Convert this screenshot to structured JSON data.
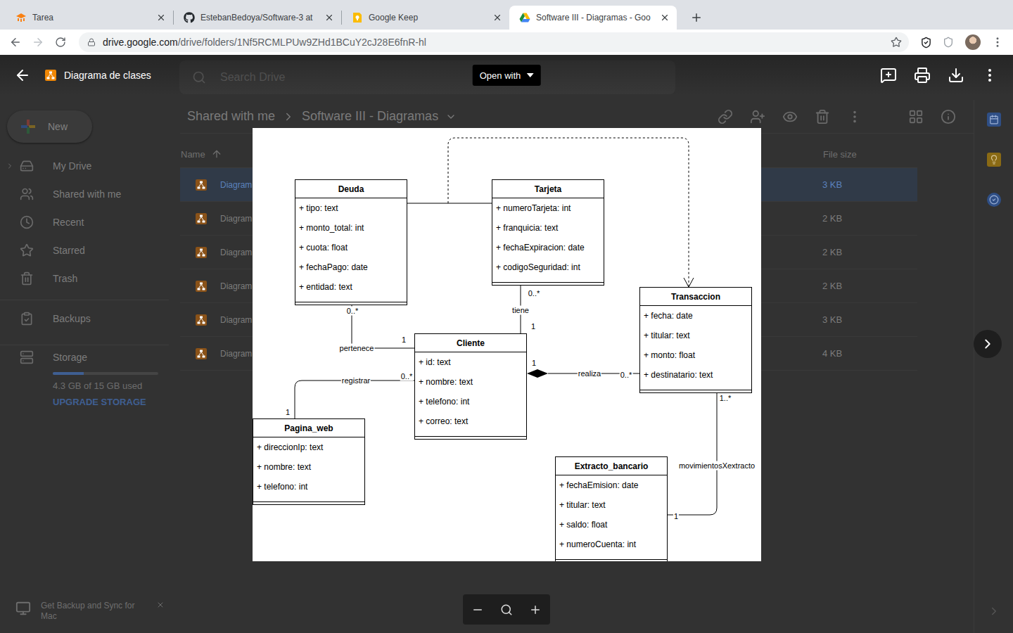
{
  "browser": {
    "tabs": [
      {
        "title": "Tarea",
        "kind": "moodle",
        "selected": false
      },
      {
        "title": "EstebanBedoya/Software-3 at",
        "kind": "github",
        "selected": false
      },
      {
        "title": "Google Keep",
        "kind": "keep",
        "selected": false
      },
      {
        "title": "Software III - Diagramas - Goo",
        "kind": "drive",
        "selected": true
      }
    ],
    "address": {
      "host": "drive.google.com",
      "path": "/drive/folders/1Nf5RCMLPUw9ZHd1BCuY2cJ28E6fnR-hl"
    }
  },
  "drive": {
    "search_placeholder": "Search Drive",
    "new_button": "New",
    "nav": [
      {
        "label": "My Drive",
        "expandable": true,
        "selected": false
      },
      {
        "label": "Shared with me",
        "expandable": false,
        "selected": false
      },
      {
        "label": "Recent",
        "expandable": false,
        "selected": false
      },
      {
        "label": "Starred",
        "expandable": false,
        "selected": false
      },
      {
        "label": "Trash",
        "expandable": false,
        "selected": false
      }
    ],
    "backups": "Backups",
    "storage": {
      "label": "Storage",
      "level": 0.29,
      "used": "4.3 GB of 15 GB used",
      "upgrade": "UPGRADE STORAGE"
    },
    "breadcrumb": [
      "Shared with me",
      "Software III - Diagramas"
    ],
    "columns": {
      "name": "Name",
      "size": "File size"
    },
    "files": [
      {
        "name": "Diagram",
        "size": "3 KB",
        "selected": true
      },
      {
        "name": "Diagram",
        "size": "2 KB",
        "selected": false
      },
      {
        "name": "Diagram",
        "size": "2 KB",
        "selected": false
      },
      {
        "name": "Diagram",
        "size": "2 KB",
        "selected": false
      },
      {
        "name": "Diagram",
        "size": "3 KB",
        "selected": false
      },
      {
        "name": "Diagram",
        "size": "4 KB",
        "selected": false
      }
    ],
    "promo": "Get Backup and Sync for Mac"
  },
  "viewer": {
    "title": "Diagrama de clases",
    "open_with": "Open with"
  },
  "diagram": {
    "classes": [
      {
        "name": "Deuda",
        "attributes": [
          "+ tipo: text",
          "+ monto_total: int",
          "+ cuota: float",
          "+ fechaPago: date",
          "+ entidad: text"
        ]
      },
      {
        "name": "Tarjeta",
        "attributes": [
          "+ numeroTarjeta: int",
          "+ franquicia: text",
          "+ fechaExpiracion: date",
          "+ codigoSeguridad: int"
        ]
      },
      {
        "name": "Transaccion",
        "attributes": [
          "+ fecha: date",
          "+ titular: text",
          "+ monto: float",
          "+ destinatario: text"
        ]
      },
      {
        "name": "Cliente",
        "attributes": [
          "+ id: text",
          "+ nombre: text",
          "+ telefono: int",
          "+ correo: text"
        ]
      },
      {
        "name": "Pagina_web",
        "attributes": [
          "+ direccionIp: text",
          "+ nombre: text",
          "+ telefono: int"
        ]
      },
      {
        "name": "Extracto_bancario",
        "attributes": [
          "+ fechaEmision: date",
          "+ titular: text",
          "+ saldo: float",
          "+ numeroCuenta: int"
        ]
      }
    ],
    "relations": [
      {
        "from": "Deuda",
        "to": "Cliente",
        "kind": "association",
        "label": "pertenece",
        "from_mult": "0..*",
        "to_mult": "1"
      },
      {
        "from": "Tarjeta",
        "to": "Cliente",
        "kind": "association",
        "label": "tiene",
        "from_mult": "0..*",
        "to_mult": "1"
      },
      {
        "from": "Cliente",
        "to": "Transaccion",
        "kind": "composition",
        "label": "realiza",
        "from_mult": "1",
        "to_mult": "0..*"
      },
      {
        "from": "Cliente",
        "to": "Pagina_web",
        "kind": "association",
        "label": "registrar",
        "from_mult": "0..*",
        "to_mult": "1"
      },
      {
        "from": "Transaccion",
        "to": "Extracto_bancario",
        "kind": "association",
        "label": "movimientosXextracto",
        "from_mult": "1..*",
        "to_mult": "1"
      },
      {
        "from": "Deuda",
        "to": "Tarjeta",
        "kind": "association"
      },
      {
        "from": "Deuda-Tarjeta",
        "to": "Transaccion",
        "kind": "dependency"
      }
    ]
  }
}
